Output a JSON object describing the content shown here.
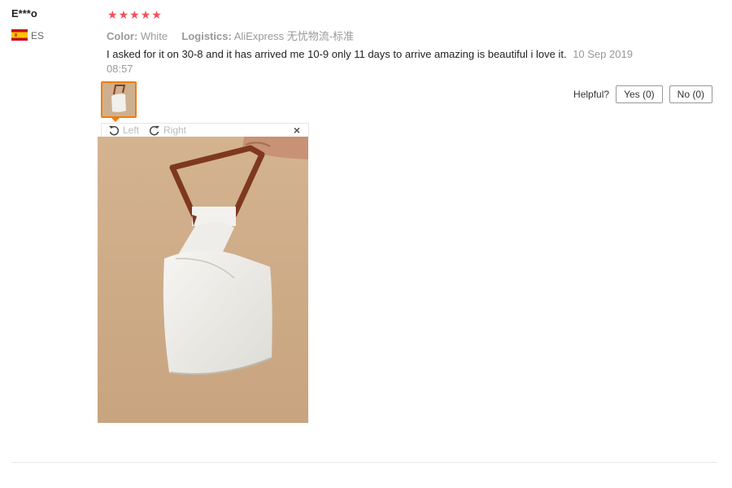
{
  "review": {
    "user": "E***o",
    "country": "ES",
    "rating": 5,
    "color_label": "Color:",
    "color_value": "White",
    "logistics_label": "Logistics:",
    "logistics_value": "AliExpress 无忧物流-标准",
    "text": "I asked for it on 30-8 and it has arrived me 10-9 only 11 days to arrive amazing is beautiful i love it.",
    "date": "10 Sep 2019 08:57"
  },
  "helpful": {
    "label": "Helpful?",
    "yes": "Yes (0)",
    "no": "No (0)"
  },
  "viewer": {
    "left_label": "Left",
    "right_label": "Right",
    "close_label": "×"
  },
  "icons": {
    "star": "star-icon",
    "flag": "spain-flag-icon",
    "rotate_left": "rotate-left-icon",
    "rotate_right": "rotate-right-icon",
    "close": "close-icon"
  },
  "colors": {
    "star": "#f2505a",
    "accent": "#f07d0f",
    "muted": "#999999"
  }
}
